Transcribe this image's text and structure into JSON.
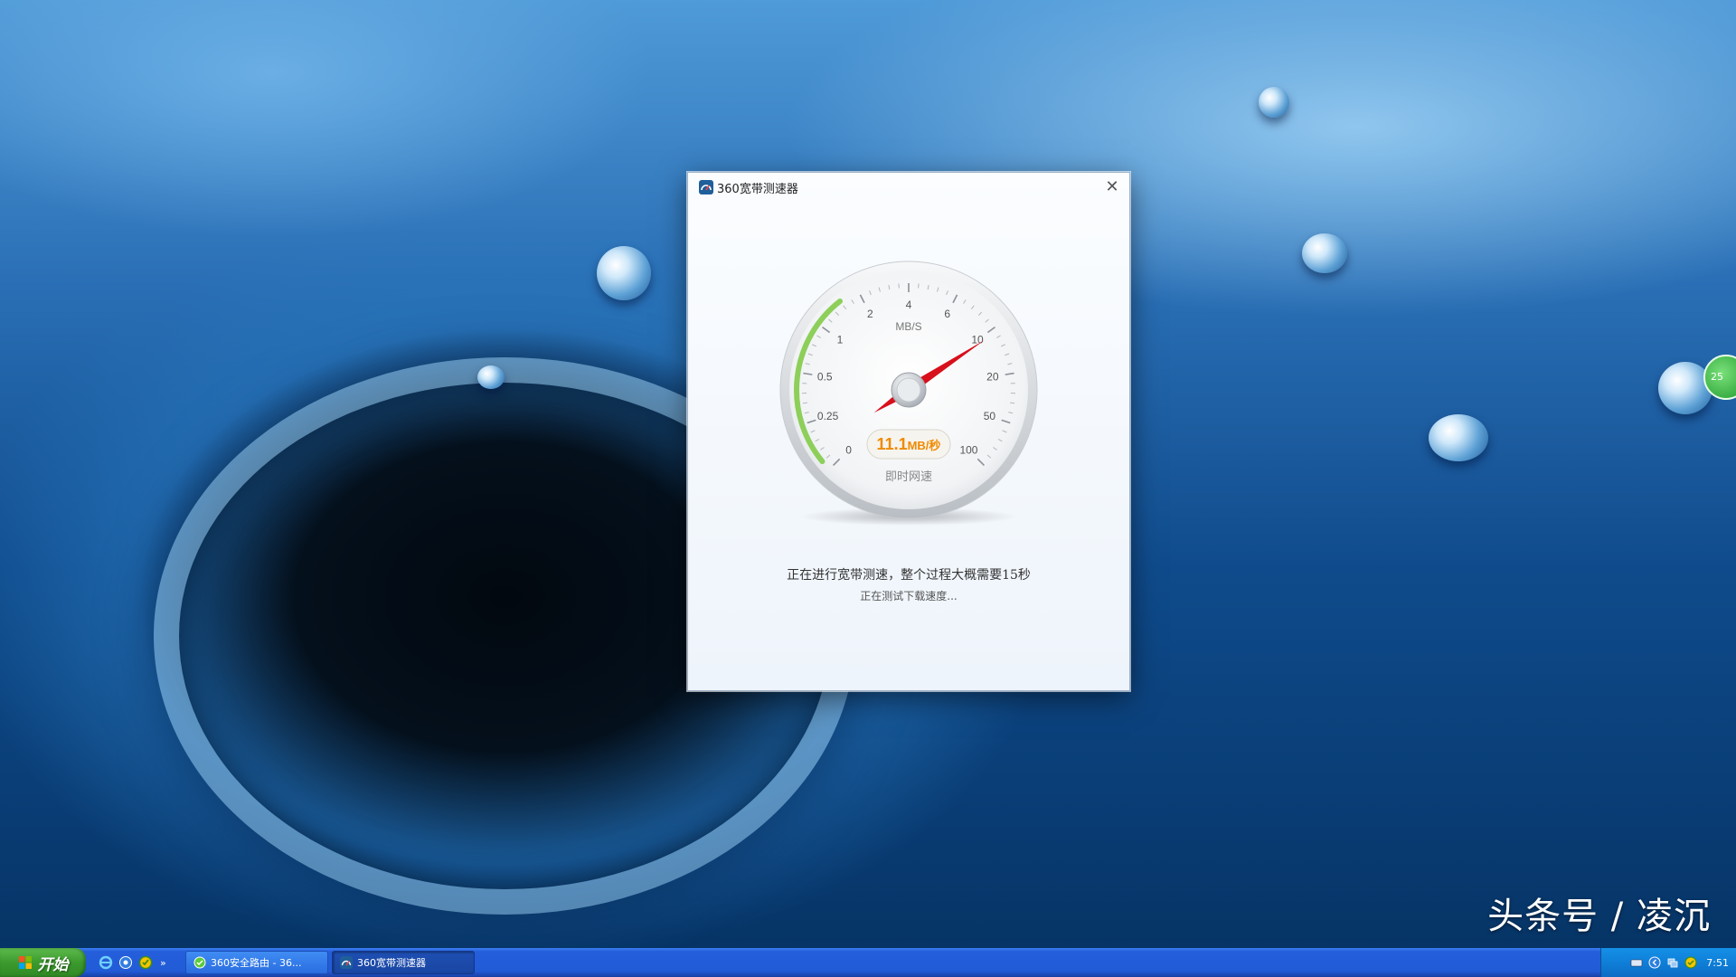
{
  "window": {
    "title": "360宽带测速器",
    "close_label": "✕"
  },
  "gauge": {
    "unit_label": "MB/S",
    "tick_labels": [
      "0",
      "0.25",
      "0.5",
      "1",
      "2",
      "4",
      "6",
      "10",
      "20",
      "50",
      "100"
    ],
    "speed_value": "11.1",
    "speed_unit": "MB/秒",
    "caption": "即时网速",
    "needle_fraction": 0.71
  },
  "status": {
    "main": "正在进行宽带测速，整个过程大概需要15秒",
    "sub": "正在测试下载速度..."
  },
  "taskbar": {
    "start_label": "开始",
    "quicklaunch_more": "»",
    "tasks": [
      {
        "label": "360安全路由 - 36..."
      },
      {
        "label": "360宽带测速器"
      }
    ],
    "clock": "7:51"
  },
  "desktop": {
    "watermark": "头条号 / 凌沉",
    "side_widget": "25"
  },
  "colors": {
    "needle": "#d7101b",
    "speed_text": "#f08a00",
    "taskbar": "#245edb",
    "start": "#3c9a2e",
    "gauge_green": "#8dcf5a"
  },
  "icons": {
    "app": "speedometer-icon",
    "close": "close-icon",
    "start": "windows-logo-icon",
    "ie": "internet-explorer-icon",
    "browser": "browser-icon",
    "360": "360-safe-icon"
  }
}
